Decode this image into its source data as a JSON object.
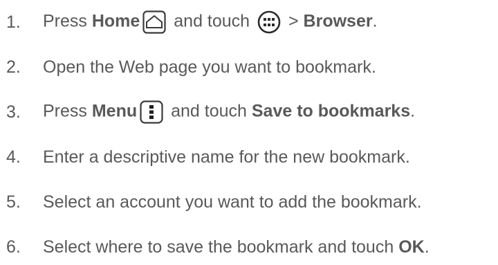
{
  "steps": [
    {
      "number": "1.",
      "segments": [
        {
          "text": "Press ",
          "bold": false
        },
        {
          "text": "Home",
          "bold": true
        },
        {
          "icon": "home-key-icon"
        },
        {
          "text": " and touch ",
          "bold": false
        },
        {
          "icon": "apps-launcher-icon"
        },
        {
          "text": " > ",
          "bold": false
        },
        {
          "text": "Browser",
          "bold": true
        },
        {
          "text": ".",
          "bold": false
        }
      ]
    },
    {
      "number": "2.",
      "segments": [
        {
          "text": "Open the Web page you want to bookmark.",
          "bold": false
        }
      ]
    },
    {
      "number": "3.",
      "segments": [
        {
          "text": "Press ",
          "bold": false
        },
        {
          "text": "Menu",
          "bold": true
        },
        {
          "icon": "menu-key-icon"
        },
        {
          "text": " and touch ",
          "bold": false
        },
        {
          "text": "Save to bookmarks",
          "bold": true
        },
        {
          "text": ".",
          "bold": false
        }
      ]
    },
    {
      "number": "4.",
      "segments": [
        {
          "text": "Enter a descriptive name for the new bookmark.",
          "bold": false
        }
      ]
    },
    {
      "number": "5.",
      "segments": [
        {
          "text": "Select an account you want to add the bookmark.",
          "bold": false
        }
      ]
    },
    {
      "number": "6.",
      "segments": [
        {
          "text": "Select where to save the bookmark and touch ",
          "bold": false
        },
        {
          "text": "OK",
          "bold": true
        },
        {
          "text": ".",
          "bold": false
        }
      ]
    }
  ],
  "colors": {
    "text": "#58595b",
    "icon": "#3a3a3c"
  }
}
